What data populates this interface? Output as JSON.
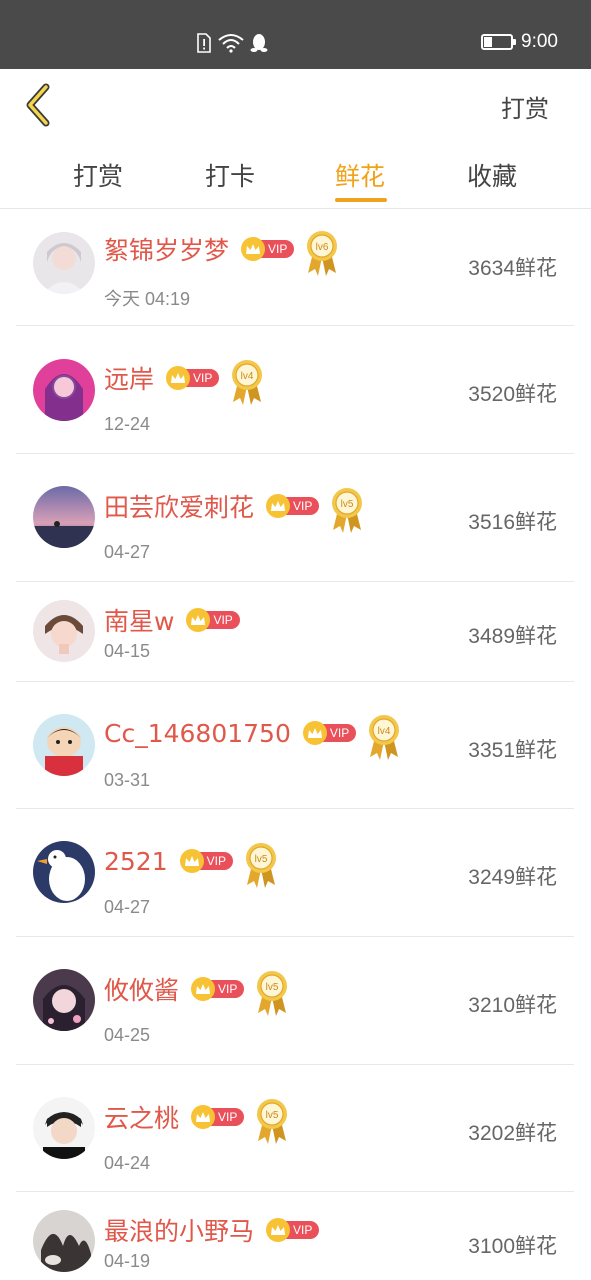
{
  "status_bar": {
    "time": "9:00",
    "icons": [
      "sim-alert-icon",
      "wifi-icon",
      "qq-penguin-icon",
      "battery-icon"
    ]
  },
  "header": {
    "back_icon": "chevron-left-icon",
    "action_label": "打赏"
  },
  "tabs": [
    {
      "label": "打赏",
      "active": false
    },
    {
      "label": "打卡",
      "active": false
    },
    {
      "label": "鲜花",
      "active": true
    },
    {
      "label": "收藏",
      "active": false
    }
  ],
  "colors": {
    "accent": "#f0a21b",
    "name": "#e0584a",
    "vip": "#e9505a",
    "crown": "#f7c233",
    "status_bar": "#4a4a4a"
  },
  "users": [
    {
      "name": "絮锦岁岁梦",
      "date": "今天 04:19",
      "flowers": "3634鲜花",
      "vip": "VIP",
      "level": "lv6"
    },
    {
      "name": "远岸",
      "date": "12-24",
      "flowers": "3520鲜花",
      "vip": "VIP",
      "level": "lv4"
    },
    {
      "name": "田芸欣爱刺花",
      "date": "04-27",
      "flowers": "3516鲜花",
      "vip": "VIP",
      "level": "lv5"
    },
    {
      "name": "南星w",
      "date": "04-15",
      "flowers": "3489鲜花",
      "vip": "VIP",
      "level": ""
    },
    {
      "name": "Cc_146801750",
      "date": "03-31",
      "flowers": "3351鲜花",
      "vip": "VIP",
      "level": "lv4"
    },
    {
      "name": "2521",
      "date": "04-27",
      "flowers": "3249鲜花",
      "vip": "VIP",
      "level": "lv5"
    },
    {
      "name": "攸攸酱",
      "date": "04-25",
      "flowers": "3210鲜花",
      "vip": "VIP",
      "level": "lv5"
    },
    {
      "name": "云之桃",
      "date": "04-24",
      "flowers": "3202鲜花",
      "vip": "VIP",
      "level": "lv5"
    },
    {
      "name": "最浪的小野马",
      "date": "04-19",
      "flowers": "3100鲜花",
      "vip": "VIP",
      "level": ""
    }
  ]
}
